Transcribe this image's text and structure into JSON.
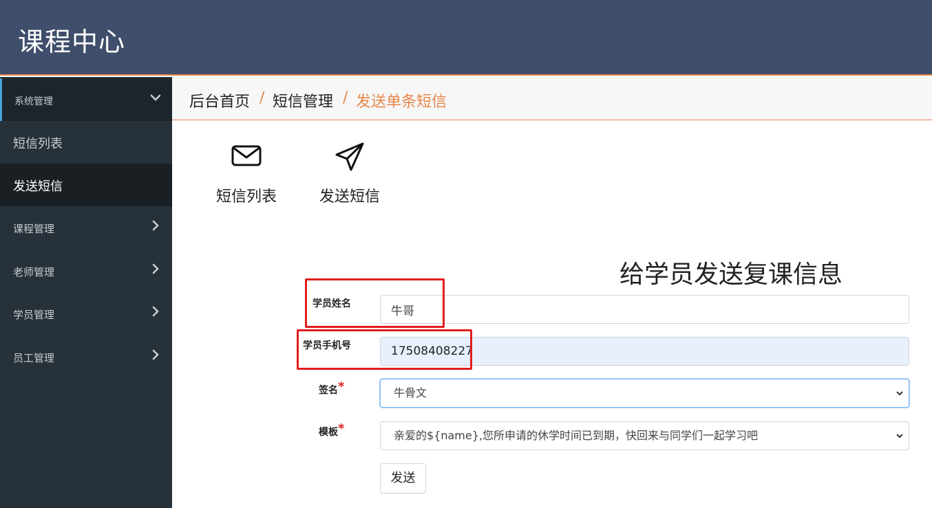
{
  "header": {
    "title": "课程中心"
  },
  "sidebar": {
    "groups": [
      {
        "label": "系统管理"
      },
      {
        "label": "课程管理"
      },
      {
        "label": "老师管理"
      },
      {
        "label": "学员管理"
      },
      {
        "label": "员工管理"
      }
    ],
    "sub_items": [
      {
        "label": "短信列表"
      },
      {
        "label": "发送短信"
      }
    ]
  },
  "breadcrumb": {
    "items": [
      "后台首页",
      "短信管理",
      "发送单条短信"
    ],
    "separator": "/"
  },
  "shortcuts": [
    {
      "label": "短信列表",
      "icon": "envelope-icon"
    },
    {
      "label": "发送短信",
      "icon": "paper-plane-icon"
    }
  ],
  "form": {
    "title": "给学员发送复课信息",
    "name_label": "学员姓名",
    "name_value": "牛哥",
    "phone_label": "学员手机号",
    "phone_value": "17508408227",
    "signature_label": "签名",
    "signature_value": "牛骨文",
    "template_label": "模板",
    "template_value": "亲爱的${name},您所申请的休学时间已到期，快回来与同学们一起学习吧",
    "required_mark": "*",
    "submit_label": "发送"
  },
  "colors": {
    "header_bg": "#3e4e6b",
    "accent": "#e8854a",
    "sidebar_bg": "#26313a",
    "highlight_box": "#e01e1e"
  }
}
